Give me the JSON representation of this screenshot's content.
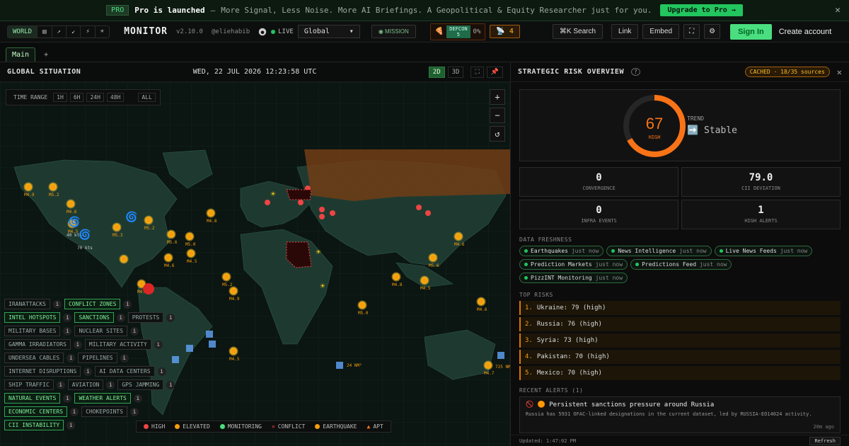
{
  "promo": {
    "badge": "PRO",
    "headline": "Pro is launched",
    "sep": " – ",
    "text": "More Signal, Less Noise. More AI Briefings. A Geopolitical & Equity Researcher just for you.",
    "cta": "Upgrade to Pro →",
    "close": "✕"
  },
  "topbar": {
    "modes": [
      {
        "label": "WORLD",
        "icon": "globe-icon"
      },
      {
        "label": "▤",
        "icon": "monitor-icon"
      },
      {
        "label": "↗",
        "icon": "chart-icon"
      },
      {
        "label": "↙",
        "icon": "arrow-icon"
      },
      {
        "label": "⚡",
        "icon": "bolt-icon"
      },
      {
        "label": "☀",
        "icon": "sun-icon"
      }
    ],
    "app_name": "MONITOR",
    "version": "v2.10.0",
    "handle": "@eliehabib",
    "live": "LIVE",
    "region": "Global",
    "mission": "MISSION",
    "defcon_label": "DEFCON",
    "defcon_level": "5",
    "defcon_pct": "0%",
    "alerts_count": "4",
    "search": "⌘K Search",
    "link": "Link",
    "embed": "Embed",
    "signin": "Sign In",
    "create": "Create account"
  },
  "tabs": {
    "main": "Main",
    "add": "+"
  },
  "map": {
    "title": "GLOBAL SITUATION",
    "datetime": "WED, 22 JUL 2026 12:23:58 UTC",
    "view_2d": "2D",
    "view_3d": "3D",
    "time_range": {
      "label": "TIME RANGE",
      "options": [
        "1H",
        "6H",
        "24H",
        "48H",
        "ALL"
      ]
    },
    "zoom_in": "+",
    "zoom_out": "−",
    "reset": "↺",
    "layers": [
      [
        {
          "label": "IRANATTACKS",
          "on": false
        },
        {
          "label": "CONFLICT ZONES",
          "on": true
        }
      ],
      [
        {
          "label": "INTEL HOTSPOTS",
          "on": true
        },
        {
          "label": "SANCTIONS",
          "on": true
        },
        {
          "label": "PROTESTS",
          "on": false
        }
      ],
      [
        {
          "label": "MILITARY BASES",
          "on": false
        },
        {
          "label": "NUCLEAR SITES",
          "on": false
        }
      ],
      [
        {
          "label": "GAMMA IRRADIATORS",
          "on": false
        },
        {
          "label": "MILITARY ACTIVITY",
          "on": false
        }
      ],
      [
        {
          "label": "UNDERSEA CABLES",
          "on": false
        },
        {
          "label": "PIPELINES",
          "on": false
        }
      ],
      [
        {
          "label": "INTERNET DISRUPTIONS",
          "on": false
        },
        {
          "label": "AI DATA CENTERS",
          "on": false
        }
      ],
      [
        {
          "label": "SHIP TRAFFIC",
          "on": false
        },
        {
          "label": "AVIATION",
          "on": false
        },
        {
          "label": "GPS JAMMING",
          "on": false
        }
      ],
      [
        {
          "label": "NATURAL EVENTS",
          "on": true
        },
        {
          "label": "WEATHER ALERTS",
          "on": true
        }
      ],
      [
        {
          "label": "ECONOMIC CENTERS",
          "on": true
        },
        {
          "label": "CHOKEPOINTS",
          "on": false
        }
      ],
      [
        {
          "label": "CII INSTABILITY",
          "on": true
        }
      ]
    ],
    "legend": [
      {
        "label": "HIGH",
        "color": "#ef4444",
        "shape": "dot"
      },
      {
        "label": "ELEVATED",
        "color": "#f59e0b",
        "shape": "dot"
      },
      {
        "label": "MONITORING",
        "color": "#4ade80",
        "shape": "dot"
      },
      {
        "label": "CONFLICT",
        "color": "#ef4444",
        "shape": "x"
      },
      {
        "label": "EARTHQUAKE",
        "color": "#f59e0b",
        "shape": "dot"
      },
      {
        "label": "APT",
        "color": "#f97316",
        "shape": "tri"
      }
    ],
    "quake_labels": [
      "M4.9",
      "M5.2",
      "M4.6",
      "M4.5",
      "M5.3",
      "M5.2",
      "M5.6",
      "M4.6",
      "M4.5",
      "M4.8",
      "M5.0",
      "M4.5",
      "M5.2",
      "M4.9",
      "M5.0",
      "M4.5",
      "M4.6",
      "M4.8",
      "M4.5",
      "M5.6",
      "M4.6",
      "M4.7"
    ],
    "storm_labels": [
      "40 kts",
      "70 kts"
    ],
    "cable_labels": [
      "24 NM²",
      "725 NM²"
    ]
  },
  "panel": {
    "title": "STRATEGIC RISK OVERVIEW",
    "help": "?",
    "cached": "CACHED · 18/35 sources",
    "close": "✕",
    "score": 67,
    "score_label": "HIGH",
    "trend_label": "TREND",
    "trend_value": "➡️ Stable",
    "stats": [
      {
        "value": "0",
        "label": "CONVERGENCE"
      },
      {
        "value": "79.0",
        "label": "CII DEVIATION"
      },
      {
        "value": "0",
        "label": "INFRA EVENTS"
      },
      {
        "value": "1",
        "label": "HIGH ALERTS"
      }
    ],
    "freshness_title": "DATA FRESHNESS",
    "freshness": [
      {
        "name": "Earthquakes",
        "age": "just now"
      },
      {
        "name": "News Intelligence",
        "age": "just now"
      },
      {
        "name": "Live News Feeds",
        "age": "just now"
      },
      {
        "name": "Prediction Markets",
        "age": "just now"
      },
      {
        "name": "Predictions Feed",
        "age": "just now"
      },
      {
        "name": "PizzINT Monitoring",
        "age": "just now"
      }
    ],
    "risks_title": "TOP RISKS",
    "risks": [
      {
        "n": "1.",
        "text": "Ukraine: 79 (high)"
      },
      {
        "n": "2.",
        "text": "Russia: 76 (high)"
      },
      {
        "n": "3.",
        "text": "Syria: 73 (high)"
      },
      {
        "n": "4.",
        "text": "Pakistan: 70 (high)"
      },
      {
        "n": "5.",
        "text": "Mexico: 70 (high)"
      }
    ],
    "alerts_title": "RECENT ALERTS (1)",
    "alert": {
      "title": "🚫 🟠 Persistent sanctions pressure around Russia",
      "body": "Russia has 5931 OFAC-linked designations in the current dataset, led by RUSSIA-EO14024 activity.",
      "time": "20m ago"
    },
    "updated": "Updated: 1:47:02 PM",
    "refresh": "Refresh"
  },
  "colors": {
    "accent": "#4ade80",
    "gauge": "#f97316",
    "risk": "#d97706",
    "high": "#ef4444",
    "elevated": "#f59e0b"
  }
}
